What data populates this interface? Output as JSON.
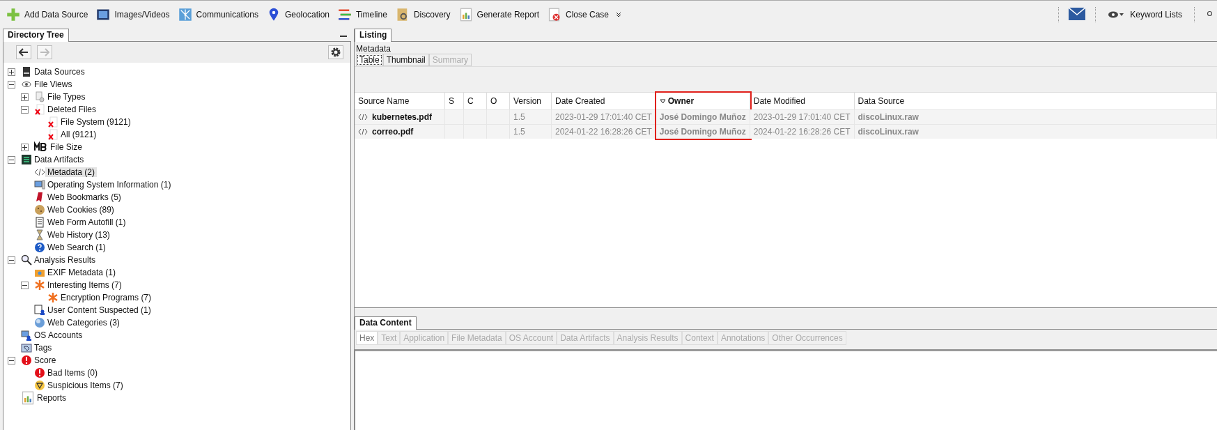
{
  "toolbar": {
    "buttons": [
      {
        "kind": "add",
        "label": "Add Data Source"
      },
      {
        "kind": "images",
        "label": "Images/Videos"
      },
      {
        "kind": "communications",
        "label": "Communications"
      },
      {
        "kind": "geolocation",
        "label": "Geolocation"
      },
      {
        "kind": "timeline",
        "label": "Timeline"
      },
      {
        "kind": "discovery",
        "label": "Discovery"
      },
      {
        "kind": "report",
        "label": "Generate Report"
      },
      {
        "kind": "close",
        "label": "Close Case"
      }
    ],
    "keyword_lists": "Keyword Lists"
  },
  "directory_tree": {
    "title": "Directory Tree",
    "items": [
      {
        "label": "Data Sources",
        "kind": "drive",
        "expanded": false,
        "selected": false
      },
      {
        "label": "File Views",
        "kind": "eye",
        "expanded": true,
        "selected": false,
        "children": [
          {
            "label": "File Types",
            "kind": "filetypes",
            "expanded": false,
            "selected": false
          },
          {
            "label": "Deleted Files",
            "kind": "deleted",
            "expanded": true,
            "selected": false,
            "children": [
              {
                "label": "File System (9121)",
                "kind": "deleted",
                "selected": false
              },
              {
                "label": "All (9121)",
                "kind": "deleted",
                "selected": false
              }
            ]
          },
          {
            "label": "File Size",
            "kind": "mb",
            "expanded": false,
            "selected": false
          }
        ]
      },
      {
        "label": "Data Artifacts",
        "kind": "artifacts",
        "expanded": true,
        "selected": false,
        "children": [
          {
            "label": "Metadata (2)",
            "kind": "code",
            "selected": true
          },
          {
            "label": "Operating System Information (1)",
            "kind": "computer",
            "selected": false
          },
          {
            "label": "Web Bookmarks (5)",
            "kind": "bookmark",
            "selected": false
          },
          {
            "label": "Web Cookies (89)",
            "kind": "cookie",
            "selected": false
          },
          {
            "label": "Web Form Autofill (1)",
            "kind": "form",
            "selected": false
          },
          {
            "label": "Web History (13)",
            "kind": "hourglass",
            "selected": false
          },
          {
            "label": "Web Search (1)",
            "kind": "help",
            "selected": false
          }
        ]
      },
      {
        "label": "Analysis Results",
        "kind": "search",
        "expanded": true,
        "selected": false,
        "children": [
          {
            "label": "EXIF Metadata (1)",
            "kind": "camera",
            "selected": false
          },
          {
            "label": "Interesting Items (7)",
            "kind": "asterisk",
            "expanded": true,
            "selected": false,
            "children": [
              {
                "label": "Encryption Programs (7)",
                "kind": "asterisk",
                "selected": false
              }
            ]
          },
          {
            "label": "User Content Suspected (1)",
            "kind": "usercontent",
            "selected": false
          },
          {
            "label": "Web Categories (3)",
            "kind": "globe",
            "selected": false
          }
        ]
      },
      {
        "label": "OS Accounts",
        "kind": "accounts",
        "selected": false
      },
      {
        "label": "Tags",
        "kind": "tag",
        "selected": false
      },
      {
        "label": "Score",
        "kind": "alert",
        "expanded": true,
        "selected": false,
        "children": [
          {
            "label": "Bad Items (0)",
            "kind": "alert",
            "selected": false
          },
          {
            "label": "Suspicious Items (7)",
            "kind": "warning",
            "selected": false
          }
        ]
      },
      {
        "label": "Reports",
        "kind": "report",
        "selected": false
      }
    ]
  },
  "listing": {
    "tab": "Listing",
    "subtitle": "Metadata",
    "view_tabs": [
      {
        "label": "Table",
        "selected": true,
        "disabled": false
      },
      {
        "label": "Thumbnail",
        "selected": false,
        "disabled": false
      },
      {
        "label": "Summary",
        "selected": false,
        "disabled": true
      }
    ],
    "columns": [
      {
        "label": "Source Name",
        "sorted": false,
        "highlighted": false
      },
      {
        "label": "S",
        "sorted": false,
        "highlighted": false
      },
      {
        "label": "C",
        "sorted": false,
        "highlighted": false
      },
      {
        "label": "O",
        "sorted": false,
        "highlighted": false
      },
      {
        "label": "Version",
        "sorted": false,
        "highlighted": false
      },
      {
        "label": "Date Created",
        "sorted": false,
        "highlighted": false
      },
      {
        "label": "Owner",
        "sorted": true,
        "highlighted": true
      },
      {
        "label": "Date Modified",
        "sorted": false,
        "highlighted": false
      },
      {
        "label": "Data Source",
        "sorted": false,
        "highlighted": false
      }
    ],
    "rows": [
      [
        "kubernetes.pdf",
        "",
        "",
        "",
        "1.5",
        "2023-01-29 17:01:40 CET",
        "José Domingo Muñoz",
        "2023-01-29 17:01:40 CET",
        "discoLinux.raw"
      ],
      [
        "correo.pdf",
        "",
        "",
        "",
        "1.5",
        "2024-01-22 16:28:26 CET",
        "José Domingo Muñoz",
        "2024-01-22 16:28:26 CET",
        "discoLinux.raw"
      ]
    ]
  },
  "data_content": {
    "tab": "Data Content",
    "tabs": [
      {
        "label": "Hex",
        "selected": true,
        "disabled": false
      },
      {
        "label": "Text",
        "selected": false,
        "disabled": true
      },
      {
        "label": "Application",
        "selected": false,
        "disabled": true
      },
      {
        "label": "File Metadata",
        "selected": false,
        "disabled": true
      },
      {
        "label": "OS Account",
        "selected": false,
        "disabled": true
      },
      {
        "label": "Data Artifacts",
        "selected": false,
        "disabled": true
      },
      {
        "label": "Analysis Results",
        "selected": false,
        "disabled": true
      },
      {
        "label": "Context",
        "selected": false,
        "disabled": true
      },
      {
        "label": "Annotations",
        "selected": false,
        "disabled": true
      },
      {
        "label": "Other Occurrences",
        "selected": false,
        "disabled": true
      }
    ]
  }
}
